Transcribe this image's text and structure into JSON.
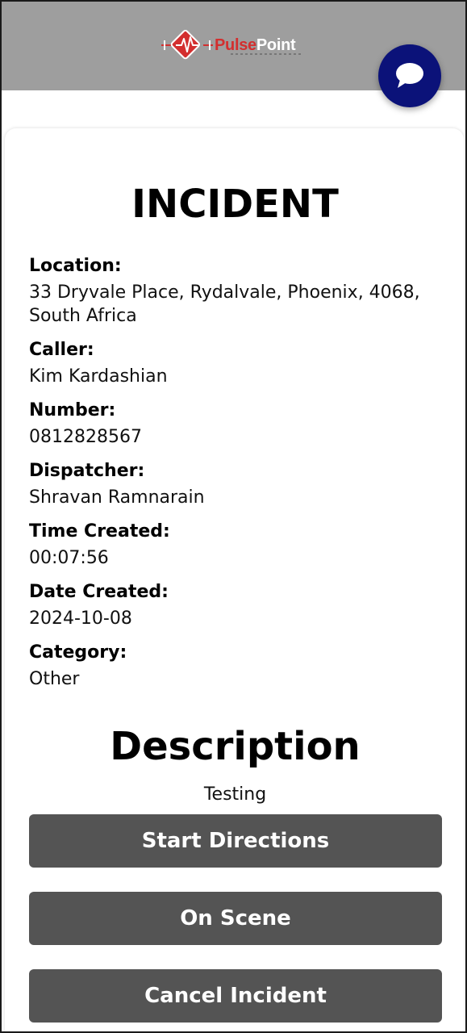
{
  "header": {
    "logo": {
      "word_pulse": "Pulse",
      "word_point": "Point",
      "icon": "heartbeat-diamond-logo"
    },
    "chat_icon": "chat-bubble-icon",
    "bar_color": "#9e9e9e",
    "chat_color": "#0b1279"
  },
  "incident": {
    "title": "INCIDENT",
    "fields": [
      {
        "label": "Location:",
        "value": "33 Dryvale Place, Rydalvale, Phoenix, 4068, South Africa"
      },
      {
        "label": "Caller:",
        "value": "Kim Kardashian"
      },
      {
        "label": "Number:",
        "value": "0812828567"
      },
      {
        "label": "Dispatcher:",
        "value": "Shravan Ramnarain"
      },
      {
        "label": "Time Created:",
        "value": "00:07:56"
      },
      {
        "label": "Date Created:",
        "value": "2024-10-08"
      },
      {
        "label": "Category:",
        "value": "Other"
      }
    ]
  },
  "description": {
    "title": "Description",
    "text": "Testing"
  },
  "actions": {
    "start_directions": "Start Directions",
    "on_scene": "On Scene",
    "cancel_incident": "Cancel Incident",
    "button_color": "#545454"
  }
}
